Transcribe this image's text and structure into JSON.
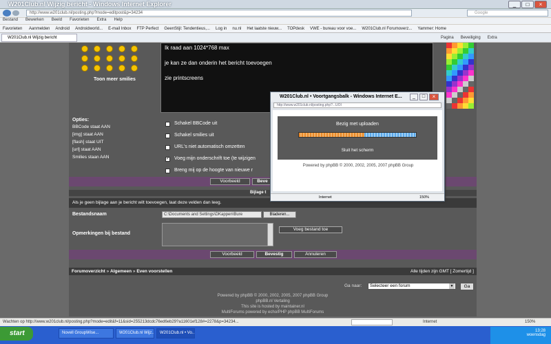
{
  "window": {
    "title": "W201Club.nl Wijzig bericht - Windows Internet Explorer"
  },
  "address": {
    "url": "http://www.w201club.nl/posting.php?mode=editpost&p=34234",
    "search_placeholder": "Google"
  },
  "menu": [
    "Bestand",
    "Bewerken",
    "Beeld",
    "Favorieten",
    "Extra",
    "Help"
  ],
  "favorites": {
    "label": "Favorieten",
    "items": [
      "Aanmelden",
      "Android",
      "Androidworld...",
      "E-mail Inbox",
      "FTP Perfect",
      "GeenStijl: Tendentieus,...",
      "Log in",
      "nu.nl",
      "Het laatste nieuw...",
      "TOPdesk",
      "VWE - bureau voor voe...",
      "W201Club.nl Forumoverz...",
      "Yammer: Home"
    ]
  },
  "tab": {
    "label": "W201Club.nl Wijzig bericht"
  },
  "cmdbar": [
    "Pagina",
    "Beveiliging",
    "Extra"
  ],
  "smilies": {
    "more_label": "Toon meer smilies"
  },
  "message": {
    "lines": [
      "Ik raad aan 1024*768 max",
      "je kan ze dan onderin het bericht toevoegen",
      "zie printscreens"
    ]
  },
  "options": {
    "heading": "Opties:",
    "lines": [
      "BBCode staat AAN",
      "[img] staat AAN",
      "[flash] staat UIT",
      "[url] staat AAN",
      "Smilies staan AAN"
    ],
    "checkboxes": [
      {
        "label": "Schakel BBCode uit",
        "checked": false
      },
      {
        "label": "Schakel smilies uit",
        "checked": false
      },
      {
        "label": "URL's niet automatisch omzetten",
        "checked": false
      },
      {
        "label": "Voeg mijn onderschrift toe (te wijzigen",
        "checked": true
      },
      {
        "label": "Breng mij op de hoogte van nieuwe r",
        "checked": false
      }
    ]
  },
  "buttons": {
    "preview": "Voorbeeld",
    "submit": "Bevestig",
    "cancel": "Annuleren",
    "submit_partial": "Beve"
  },
  "attachment": {
    "header": "Bijlage t",
    "intro": "Als je geen bijlage aan je bericht wilt toevoegen, laat deze velden dan leeg.",
    "filename_label": "Bestandsnaam",
    "filename_value": "C:\\Documents and Settings\\DKappen\\Bure",
    "browse": "Bladeren...",
    "comment_label": "Opmerkingen bij bestand",
    "add_button": "Voeg bestand toe"
  },
  "breadcrumb": {
    "items": [
      "Forumoverzicht",
      "Algemeen",
      "Even voorstellen"
    ],
    "sep": "»",
    "timezone": "Alle tijden zijn GMT [ Zomertijd ]"
  },
  "jump": {
    "label": "Ga naar:",
    "selected": "Selecteer een forum",
    "go": "Ga"
  },
  "footer": {
    "lines": [
      "Powered by phpBB © 2000, 2002, 2005, 2007 phpBB Group",
      "phpBB.nl Vertaling",
      "This site is hosted by maintainer.nl",
      "MultiForums powered by echo/PHP phpBB MultiForums"
    ]
  },
  "status": {
    "text": "Wachten op http://www.w201club.nl/posting.php?mode=edit&f=11&sid=255213dcdc76ed6eb29?a11601ef128#=2278&p=34234...",
    "zone": "Internet",
    "zoom": "150%"
  },
  "popup": {
    "title": "W201Club.nl • Voortgangsbalk - Windows Internet E...",
    "url": "http://www.w201club.nl/posting.php?...UOI",
    "uploading": "Bezig met uploaden",
    "close": "Sluit het scherm",
    "powered": "Powered by phpBB © 2000, 2002, 2005, 2007 phpBB Group",
    "progress": 0.56,
    "zone": "Internet",
    "zoom": "150%"
  },
  "taskbar": {
    "start": "start",
    "tasks": [
      "Novell GroupWise...",
      "W201Club.nl Wijz...",
      "W201Club.nl • Vo..."
    ],
    "time": "13:28",
    "day": "woensdag"
  },
  "colors": {
    "phpbb_purple": "#6b4870",
    "page_bg": "#595959",
    "progress_orange": "#e98a2a",
    "progress_blue": "#5aa7e8"
  }
}
